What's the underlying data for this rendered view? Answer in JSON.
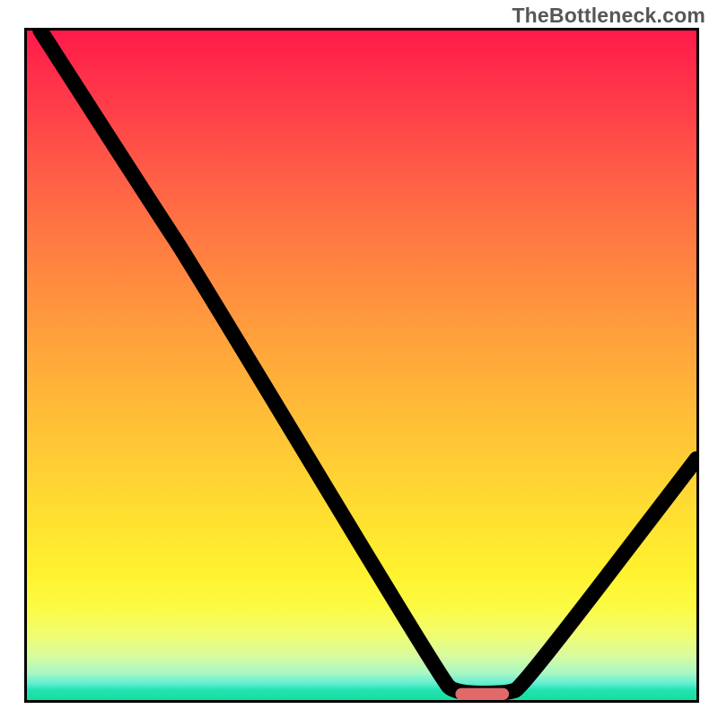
{
  "watermark": "TheBottleneck.com",
  "chart_data": {
    "type": "line",
    "title": "",
    "xlabel": "",
    "ylabel": "",
    "xlim": [
      0,
      100
    ],
    "ylim": [
      0,
      100
    ],
    "series": [
      {
        "name": "curve",
        "points": [
          {
            "x": 2,
            "y": 100
          },
          {
            "x": 20,
            "y": 72
          },
          {
            "x": 24,
            "y": 66
          },
          {
            "x": 62,
            "y": 3
          },
          {
            "x": 64,
            "y": 1
          },
          {
            "x": 72,
            "y": 1
          },
          {
            "x": 74,
            "y": 2
          },
          {
            "x": 100,
            "y": 36
          }
        ]
      }
    ],
    "marker": {
      "x_start": 64,
      "x_end": 72,
      "y": 0.9
    },
    "gradient_colors": {
      "top": "#ff1a4b",
      "mid": "#ffd533",
      "bottom": "#17dd9e"
    }
  }
}
